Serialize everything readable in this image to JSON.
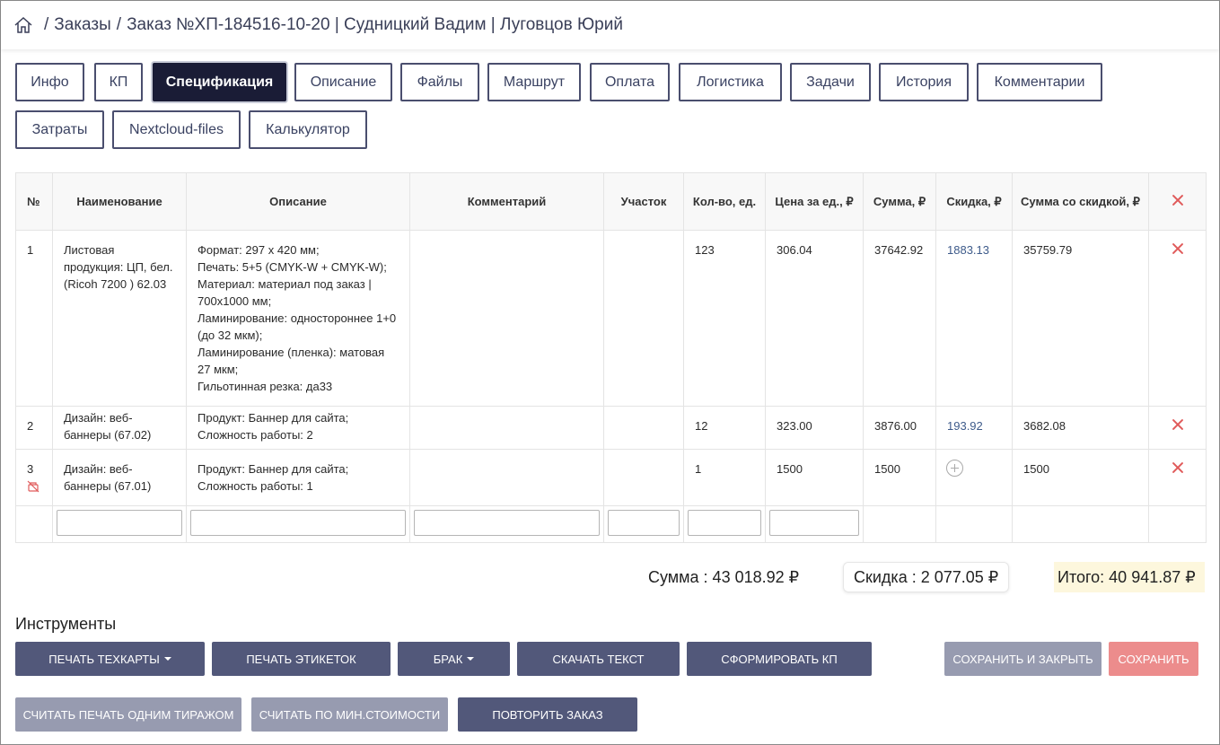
{
  "breadcrumb": {
    "home_icon": "home-icon",
    "items": [
      "Заказы",
      "Заказ №ХП-184516-10-20 | Судницкий Вадим | Луговцов Юрий"
    ]
  },
  "tabs": [
    {
      "label": "Инфо"
    },
    {
      "label": "КП"
    },
    {
      "label": "Спецификация",
      "active": true
    },
    {
      "label": "Описание"
    },
    {
      "label": "Файлы"
    },
    {
      "label": "Маршрут"
    },
    {
      "label": "Оплата"
    },
    {
      "label": "Логистика"
    },
    {
      "label": "Задачи"
    },
    {
      "label": "История"
    },
    {
      "label": "Комментарии"
    },
    {
      "label": "Затраты"
    },
    {
      "label": "Nextcloud-files"
    },
    {
      "label": "Калькулятор"
    }
  ],
  "table": {
    "headers": [
      "№",
      "Наименование",
      "Описание",
      "Комментарий",
      "Участок",
      "Кол-во, ед.",
      "Цена за ед., ₽",
      "Сумма, ₽",
      "Скидка, ₽",
      "Сумма со скидкой, ₽"
    ],
    "rows": [
      {
        "num": "1",
        "name": "Листовая продукция: ЦП, бел. (Ricoh 7200 ) 62.03",
        "description": [
          "Формат: 297 х 420 мм;",
          "Печать: 5+5 (CMYK-W + CMYK-W);",
          "Материал: материал под заказ | 700х1000 мм;",
          "Ламинирование: одностороннее 1+0 (до 32 мкм);",
          "Ламинирование (пленка): матовая 27 мкм;",
          "Гильотинная резка: да33"
        ],
        "comment": "",
        "area": "",
        "qty": "123",
        "price": "306.04",
        "sum": "37642.92",
        "discount": "1883.13",
        "sum_discount": "35759.79"
      },
      {
        "num": "2",
        "name": "Дизайн: веб-баннеры (67.02)",
        "description": [
          "Продукт: Баннер для сайта;",
          "Сложность работы: 2"
        ],
        "comment": "",
        "area": "",
        "qty": "12",
        "price": "323.00",
        "sum": "3876.00",
        "discount": "193.92",
        "sum_discount": "3682.08"
      },
      {
        "num": "3",
        "name": "Дизайн: веб-баннеры (67.01)",
        "description": [
          "Продукт: Баннер для сайта;",
          "Сложность работы: 1"
        ],
        "comment": "",
        "area": "",
        "qty": "1",
        "price": "1500",
        "sum": "1500",
        "discount": "",
        "sum_discount": "1500"
      }
    ]
  },
  "totals": {
    "sum": "Сумма : 43 018.92 ₽",
    "discount": "Скидка : 2 077.05 ₽",
    "total": "Итого: 40 941.87 ₽"
  },
  "tools": {
    "title": "Инструменты",
    "print_techcards": "Печать техкарты",
    "print_labels": "Печать этикеток",
    "defect": "Брак",
    "download_text": "Скачать текст",
    "make_kp": "Сформировать КП",
    "save_close": "Сохранить и закрыть",
    "save": "Сохранить",
    "one_run": "Считать печать одним тиражом",
    "min_cost": "Считать по мин.стоимости",
    "repeat_order": "Повторить заказ"
  },
  "colors": {
    "accent_dark": "#1a1c36",
    "button_dark": "#52587a",
    "button_gray": "#979bb0",
    "button_red": "#ec8c8c",
    "delete_red": "#e05a5a",
    "total_highlight": "#fdf7dd"
  }
}
